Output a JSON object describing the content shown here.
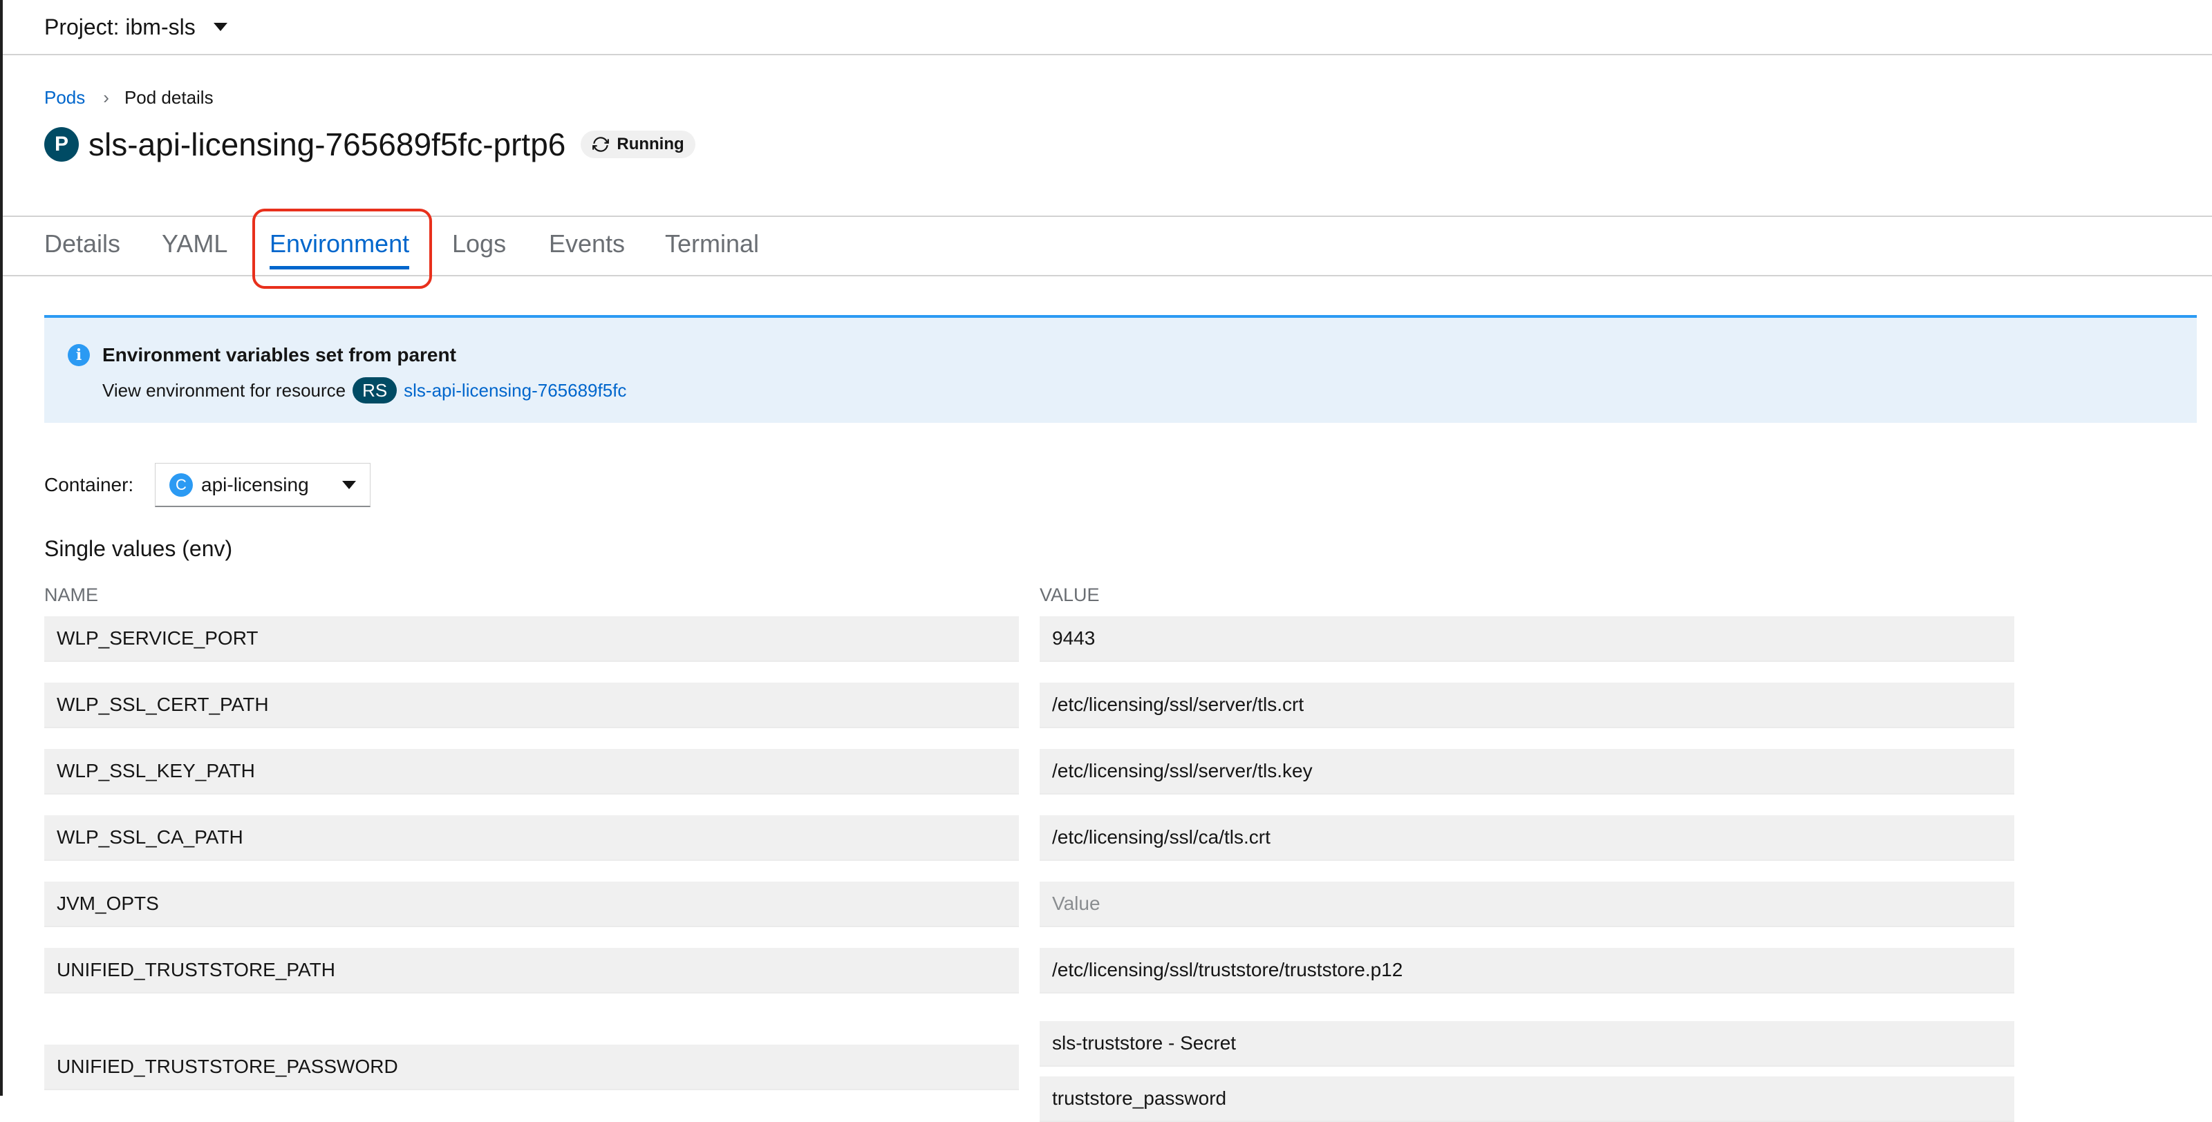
{
  "project": {
    "label": "Project: ibm-sls"
  },
  "breadcrumb": {
    "parent": "Pods",
    "current": "Pod details"
  },
  "title": {
    "badge": "P",
    "name": "sls-api-licensing-765689f5fc-prtp6",
    "status": "Running"
  },
  "tabs": [
    {
      "label": "Details"
    },
    {
      "label": "YAML"
    },
    {
      "label": "Environment"
    },
    {
      "label": "Logs"
    },
    {
      "label": "Events"
    },
    {
      "label": "Terminal"
    }
  ],
  "alert": {
    "title": "Environment variables set from parent",
    "body_prefix": "View environment for resource",
    "badge": "RS",
    "link": "sls-api-licensing-765689f5fc"
  },
  "container": {
    "label": "Container:",
    "badge": "C",
    "value": "api-licensing"
  },
  "section": {
    "title": "Single values (env)",
    "name_header": "NAME",
    "value_header": "VALUE"
  },
  "env": [
    {
      "name": "WLP_SERVICE_PORT",
      "value": "9443"
    },
    {
      "name": "WLP_SSL_CERT_PATH",
      "value": "/etc/licensing/ssl/server/tls.crt"
    },
    {
      "name": "WLP_SSL_KEY_PATH",
      "value": "/etc/licensing/ssl/server/tls.key"
    },
    {
      "name": "WLP_SSL_CA_PATH",
      "value": "/etc/licensing/ssl/ca/tls.crt"
    },
    {
      "name": "JVM_OPTS",
      "value_placeholder": "Value"
    },
    {
      "name": "UNIFIED_TRUSTSTORE_PATH",
      "value": "/etc/licensing/ssl/truststore/truststore.p12"
    },
    {
      "name": "UNIFIED_TRUSTSTORE_PASSWORD",
      "value": "sls-truststore - Secret",
      "value_secondary": "truststore_password"
    }
  ],
  "colors": {
    "link": "#0066cc",
    "accent": "#2b9af3",
    "highlight": "#e8301c",
    "badge": "#004b64"
  }
}
